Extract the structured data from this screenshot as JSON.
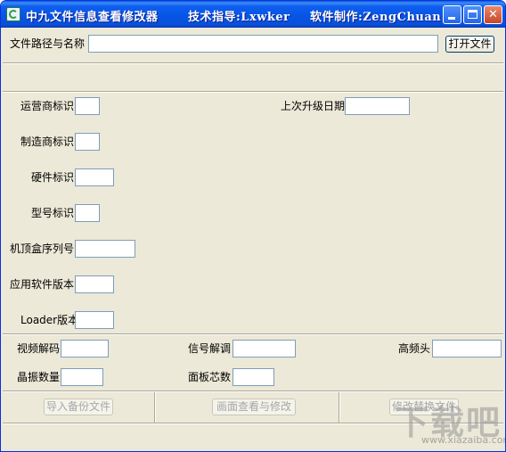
{
  "window": {
    "title": "中九文件信息查看修改器",
    "title_tech": "技术指导:Lxwker",
    "title_author": "软件制作:ZengChuan",
    "minimize_glyph": "_",
    "close_glyph": "✕"
  },
  "file": {
    "path_label": "文件路径与名称",
    "path_value": "",
    "open_button": "打开文件"
  },
  "fields": {
    "operator_id": "运营商标识",
    "last_upgrade_date": "上次升级日期",
    "manufacturer_id": "制造商标识",
    "hardware_id": "硬件标识",
    "model_id": "型号标识",
    "stb_serial": "机顶盒序列号",
    "app_version": "应用软件版本",
    "loader_version": "Loader版本",
    "video_decode": "视频解码",
    "signal_demod": "信号解调",
    "tuner": "高频头",
    "crystal_count": "晶振数量",
    "panel_chip_count": "面板芯数"
  },
  "buttons": {
    "import_backup": "导入备份文件",
    "view_edit_screen": "画面查看与修改",
    "modify_replace_file": "修改替换文件"
  },
  "watermark": {
    "text": "下载吧",
    "url": "www.xiazaiba.com"
  }
}
